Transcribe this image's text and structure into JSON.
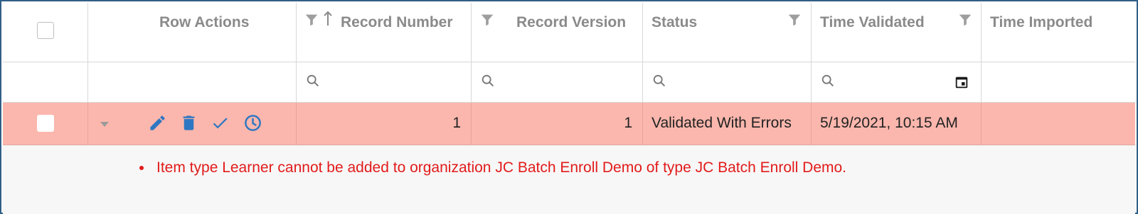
{
  "columns": {
    "row_actions": "Row Actions",
    "record_number": "Record Number",
    "record_version": "Record Version",
    "status": "Status",
    "time_validated": "Time Validated",
    "time_imported": "Time Imported"
  },
  "icons": {
    "filter": "funnel-icon",
    "sort": "sort-ascending-icon",
    "search": "search-icon",
    "calendar": "calendar-icon",
    "expand": "caret-down-icon",
    "edit": "pencil-icon",
    "delete": "trash-icon",
    "validate": "check-icon",
    "history": "clock-icon"
  },
  "rows": [
    {
      "selected": false,
      "record_number": "1",
      "record_version": "1",
      "status": "Validated With Errors",
      "time_validated": "5/19/2021, 10:15 AM",
      "time_imported": "",
      "errors": [
        "Item type Learner cannot be added to organization JC Batch Enroll Demo of type JC Batch Enroll Demo."
      ]
    }
  ],
  "colors": {
    "error_row": "#fbb7ad",
    "error_text": "#e21b1b",
    "action_icon": "#2f77c2",
    "frame_border": "#2f5f86"
  }
}
